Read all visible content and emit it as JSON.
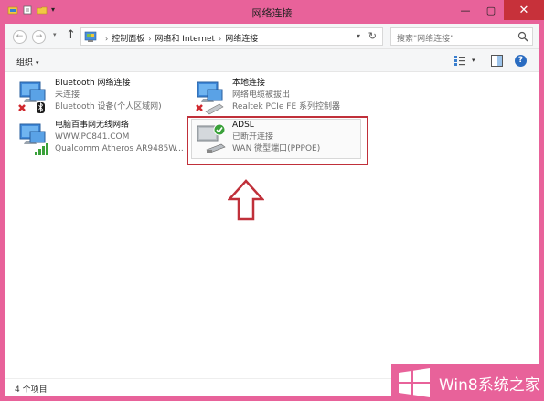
{
  "window": {
    "title": "网络连接"
  },
  "address": {
    "breadcrumbs": [
      "控制面板",
      "网络和 Internet",
      "网络连接"
    ],
    "search_placeholder": "搜索\"网络连接\""
  },
  "toolbar": {
    "organize_label": "组织"
  },
  "connections": [
    {
      "name": "Bluetooth 网络连接",
      "status": "未连接",
      "device": "Bluetooth 设备(个人区域网)",
      "icon": "bluetooth-network-icon"
    },
    {
      "name": "本地连接",
      "status": "网络电缆被拔出",
      "device": "Realtek PCIe FE 系列控制器",
      "icon": "ethernet-network-icon"
    },
    {
      "name": "电脑百事网无线网络",
      "status": "WWW.PC841.COM",
      "device": "Qualcomm Atheros AR9485W...",
      "icon": "wireless-network-icon"
    },
    {
      "name": "ADSL",
      "status": "已断开连接",
      "device": "WAN 微型端口(PPPOE)",
      "icon": "dialup-network-icon"
    }
  ],
  "status_bar": {
    "item_count": "4 个项目"
  },
  "watermark": {
    "text": "Win8系统之家"
  },
  "colors": {
    "frame": "#e8629a",
    "highlight_border": "#c0303a",
    "close_button": "#c7313a",
    "accent_blue": "#2a6cc1"
  }
}
